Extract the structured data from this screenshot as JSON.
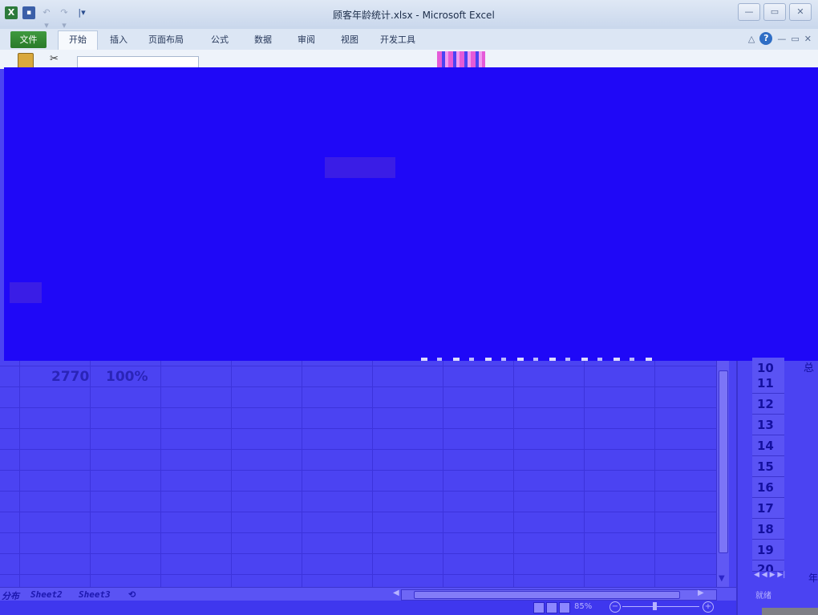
{
  "window": {
    "title": "顾客年龄统计.xlsx - Microsoft Excel",
    "qat": {
      "excel": "X",
      "save": "▪",
      "undo": "↶ ▾",
      "redo": "↷ ▾",
      "customize": "|▾"
    },
    "controls": {
      "minimize": "—",
      "restore": "▭",
      "close": "✕"
    }
  },
  "ribbon": {
    "tabs": [
      "文件",
      "开始",
      "插入",
      "页面布局",
      "公式",
      "数据",
      "审阅",
      "视图",
      "开发工具"
    ],
    "active_tab": "开始",
    "right_icons": {
      "minimize_ribbon": "△",
      "help": "?",
      "doc_minimize": "—",
      "doc_restore": "▭",
      "doc_close": "✕"
    }
  },
  "grid": {
    "visible_row_values": {
      "total_count": "2770",
      "total_percent": "100%"
    }
  },
  "right_pane": {
    "row_numbers": [
      "10",
      "11",
      "12",
      "13",
      "14",
      "15",
      "16",
      "17",
      "18",
      "19",
      "20"
    ],
    "partial_text": "总",
    "year_text": "年",
    "nav": "◀ ◀ ▶ ▶|",
    "status": "就绪"
  },
  "sheet_tabs": {
    "first_partial": "分布",
    "sheets": [
      "Sheet2",
      "Sheet3"
    ],
    "insert": "⟲"
  },
  "status_bar": {
    "zoom": "85%",
    "zoom_minus": "−",
    "zoom_plus": "+"
  },
  "colors": {
    "occlusion": "#1f08f7",
    "tint": "#4b43f2"
  }
}
